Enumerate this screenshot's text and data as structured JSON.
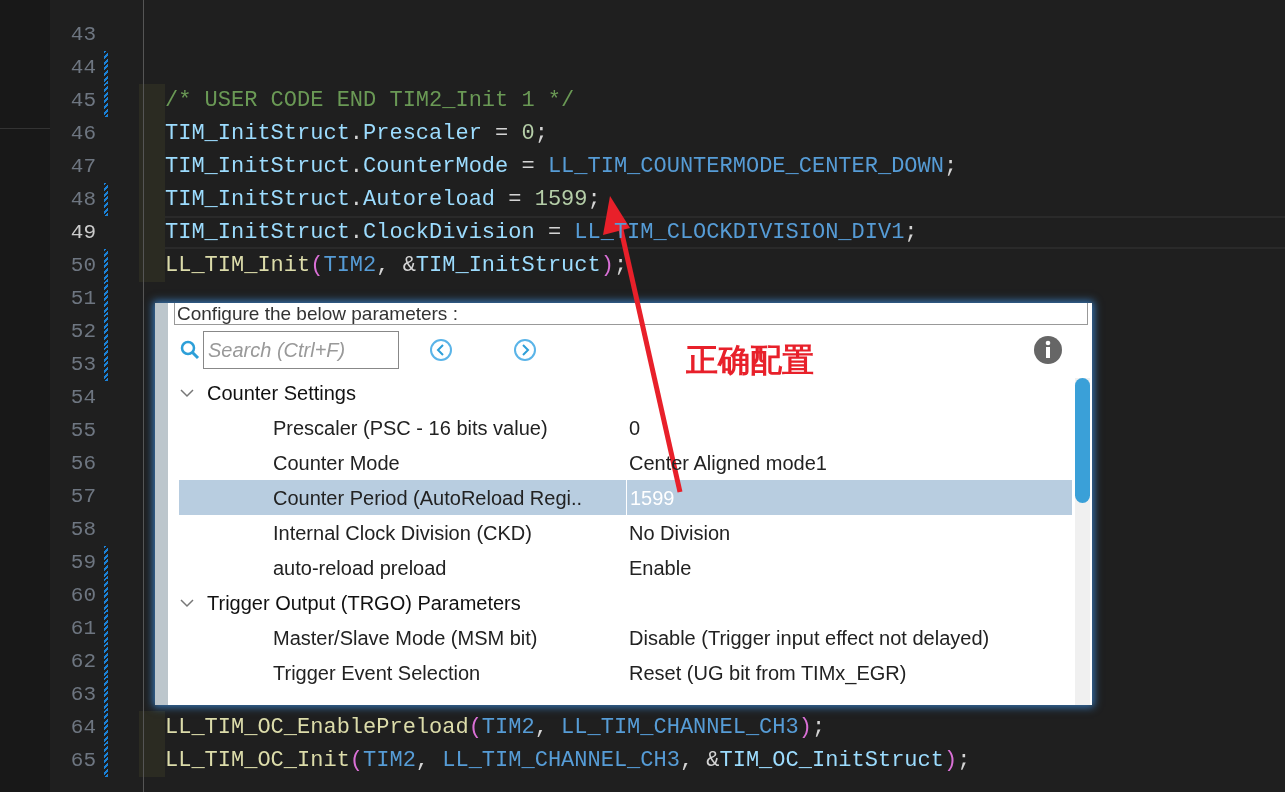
{
  "editor": {
    "lines": [
      {
        "number": "43",
        "current": false,
        "changed": false
      },
      {
        "number": "44",
        "current": false,
        "changed": true
      },
      {
        "number": "45",
        "current": false,
        "changed": true,
        "tokens": [
          {
            "text": "/* USER CODE END TIM2_Init 1 */",
            "kind": "comment"
          }
        ]
      },
      {
        "number": "46",
        "current": false,
        "changed": false,
        "tokens": [
          {
            "text": "TIM_InitStruct",
            "kind": "var"
          },
          {
            "text": ".",
            "kind": "punct"
          },
          {
            "text": "Prescaler",
            "kind": "var"
          },
          {
            "text": " = ",
            "kind": "punct"
          },
          {
            "text": "0",
            "kind": "number"
          },
          {
            "text": ";",
            "kind": "punct"
          }
        ]
      },
      {
        "number": "47",
        "current": false,
        "changed": false,
        "tokens": [
          {
            "text": "TIM_InitStruct",
            "kind": "var"
          },
          {
            "text": ".",
            "kind": "punct"
          },
          {
            "text": "CounterMode",
            "kind": "var"
          },
          {
            "text": " = ",
            "kind": "punct"
          },
          {
            "text": "LL_TIM_COUNTERMODE_CENTER_DOWN",
            "kind": "const"
          },
          {
            "text": ";",
            "kind": "punct"
          }
        ]
      },
      {
        "number": "48",
        "current": false,
        "changed": true,
        "tokens": [
          {
            "text": "TIM_InitStruct",
            "kind": "var"
          },
          {
            "text": ".",
            "kind": "punct"
          },
          {
            "text": "Autoreload",
            "kind": "var"
          },
          {
            "text": " = ",
            "kind": "punct"
          },
          {
            "text": "1599",
            "kind": "number"
          },
          {
            "text": ";",
            "kind": "punct"
          }
        ]
      },
      {
        "number": "49",
        "current": true,
        "changed": false,
        "tokens": [
          {
            "text": "TIM_InitStruct",
            "kind": "var"
          },
          {
            "text": ".",
            "kind": "punct"
          },
          {
            "text": "ClockDivision",
            "kind": "var"
          },
          {
            "text": " = ",
            "kind": "punct"
          },
          {
            "text": "LL_TIM_CLOCKDIVISION_DIV1",
            "kind": "const"
          },
          {
            "text": ";",
            "kind": "punct"
          }
        ]
      },
      {
        "number": "50",
        "current": false,
        "changed": true,
        "tokens": [
          {
            "text": "LL_TIM_Init",
            "kind": "func"
          },
          {
            "text": "(",
            "kind": "paren"
          },
          {
            "text": "TIM2",
            "kind": "const"
          },
          {
            "text": ", &",
            "kind": "punct"
          },
          {
            "text": "TIM_InitStruct",
            "kind": "var"
          },
          {
            "text": ")",
            "kind": "paren"
          },
          {
            "text": ";",
            "kind": "punct"
          }
        ]
      },
      {
        "number": "51",
        "current": false,
        "changed": true
      },
      {
        "number": "52",
        "current": false,
        "changed": true
      },
      {
        "number": "53",
        "current": false,
        "changed": true
      },
      {
        "number": "54",
        "current": false,
        "changed": false
      },
      {
        "number": "55",
        "current": false,
        "changed": false
      },
      {
        "number": "56",
        "current": false,
        "changed": false
      },
      {
        "number": "57",
        "current": false,
        "changed": false
      },
      {
        "number": "58",
        "current": false,
        "changed": false
      },
      {
        "number": "59",
        "current": false,
        "changed": true
      },
      {
        "number": "60",
        "current": false,
        "changed": true
      },
      {
        "number": "61",
        "current": false,
        "changed": true
      },
      {
        "number": "62",
        "current": false,
        "changed": true
      },
      {
        "number": "63",
        "current": false,
        "changed": true
      },
      {
        "number": "64",
        "current": false,
        "changed": true,
        "tokens": [
          {
            "text": "LL_TIM_OC_EnablePreload",
            "kind": "func"
          },
          {
            "text": "(",
            "kind": "paren"
          },
          {
            "text": "TIM2",
            "kind": "const"
          },
          {
            "text": ", ",
            "kind": "punct"
          },
          {
            "text": "LL_TIM_CHANNEL_CH3",
            "kind": "const"
          },
          {
            "text": ")",
            "kind": "paren"
          },
          {
            "text": ";",
            "kind": "punct"
          }
        ]
      },
      {
        "number": "65",
        "current": false,
        "changed": true,
        "tokens": [
          {
            "text": "LL_TIM_OC_Init",
            "kind": "func"
          },
          {
            "text": "(",
            "kind": "paren"
          },
          {
            "text": "TIM2",
            "kind": "const"
          },
          {
            "text": ", ",
            "kind": "punct"
          },
          {
            "text": "LL_TIM_CHANNEL_CH3",
            "kind": "const"
          },
          {
            "text": ", &",
            "kind": "punct"
          },
          {
            "text": "TIM_OC_InitStruct",
            "kind": "var"
          },
          {
            "text": ")",
            "kind": "paren"
          },
          {
            "text": ";",
            "kind": "punct"
          }
        ]
      }
    ]
  },
  "dialog": {
    "header": "Configure the below parameters :",
    "search": {
      "placeholder": "Search (Ctrl+F)"
    },
    "groups": [
      {
        "label": "Counter Settings",
        "expanded": true,
        "children": [
          {
            "name": "Prescaler (PSC - 16 bits value)",
            "value": "0",
            "selected": false
          },
          {
            "name": "Counter Mode",
            "value": "Center Aligned mode1",
            "selected": false
          },
          {
            "name": "Counter Period (AutoReload Regi..",
            "value": "1599",
            "selected": true
          },
          {
            "name": "Internal Clock Division (CKD)",
            "value": "No Division",
            "selected": false
          },
          {
            "name": "auto-reload preload",
            "value": "Enable",
            "selected": false
          }
        ]
      },
      {
        "label": "Trigger Output (TRGO) Parameters",
        "expanded": true,
        "children": [
          {
            "name": "Master/Slave Mode (MSM bit)",
            "value": "Disable (Trigger input effect not delayed)",
            "selected": false
          },
          {
            "name": "Trigger Event Selection",
            "value": "Reset (UG bit from TIMx_EGR)",
            "selected": false
          }
        ]
      }
    ]
  },
  "annotation": {
    "text": "正确配置"
  }
}
